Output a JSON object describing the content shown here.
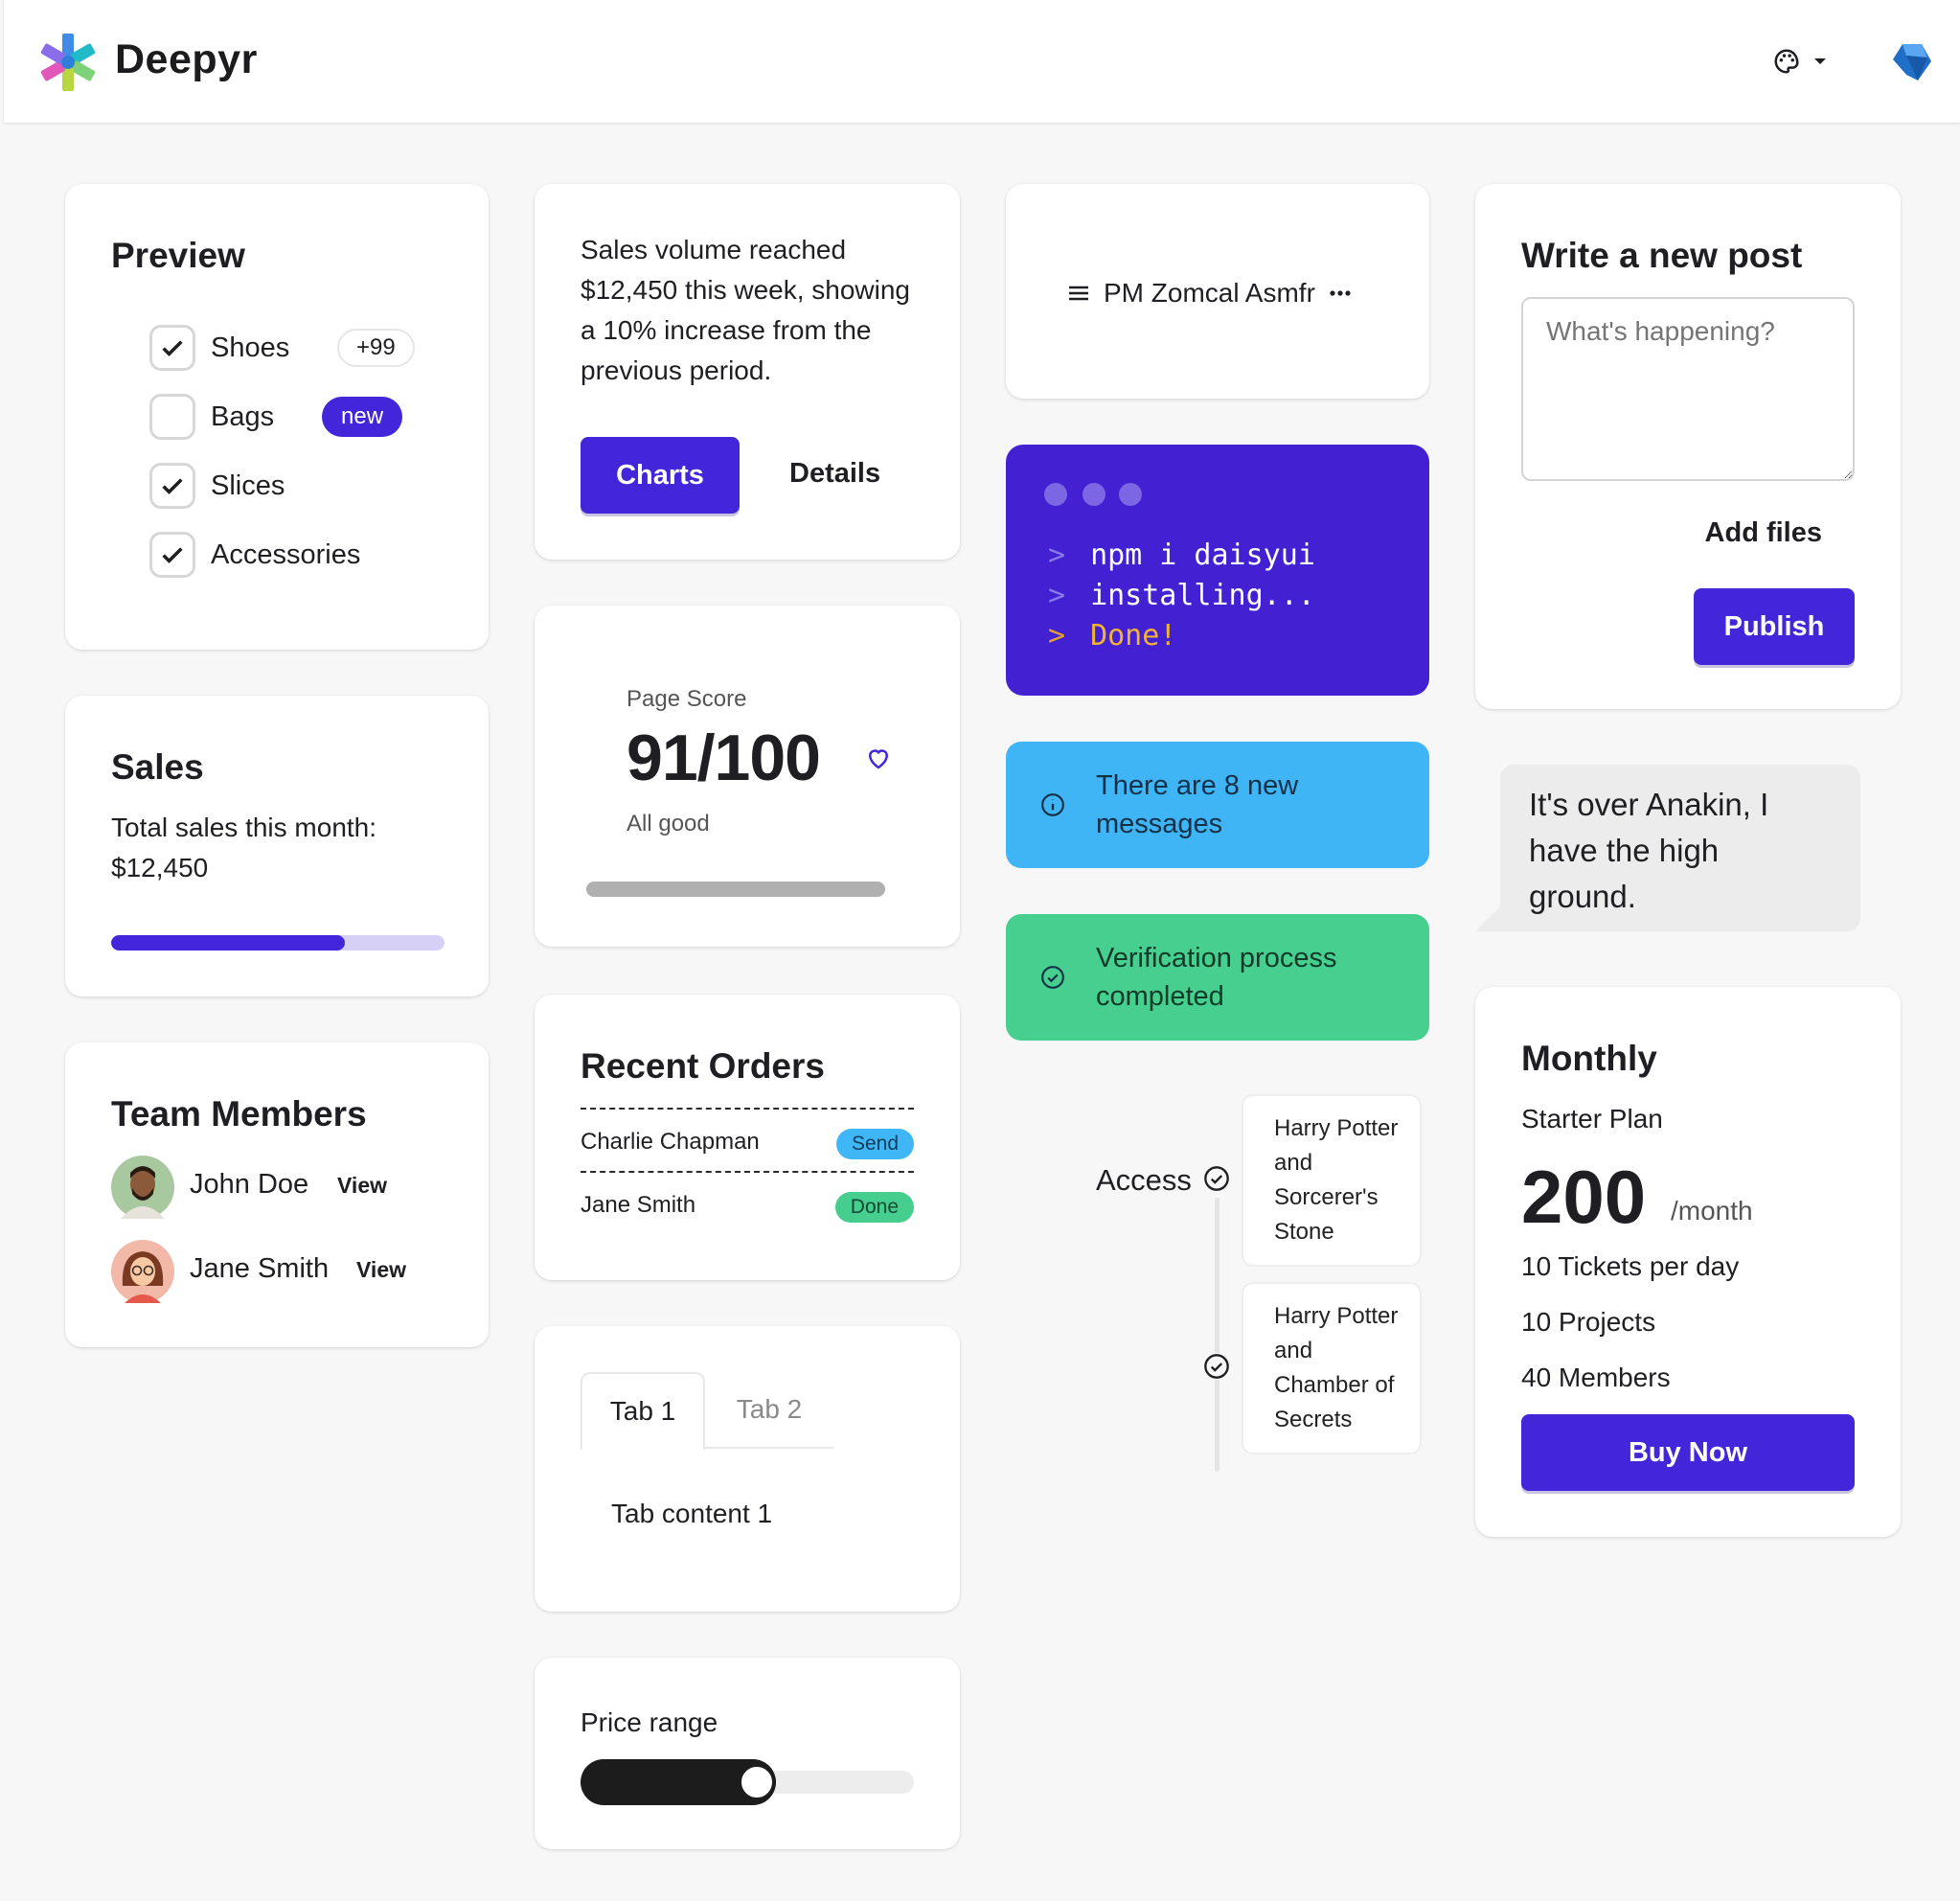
{
  "brand": {
    "name": "Deepyr"
  },
  "navbar": {
    "theme_icon": "palette-icon",
    "menu_icon": "chevron-down-icon",
    "gem_icon": "diamond-icon"
  },
  "colors": {
    "primary": "#4326d9",
    "info": "#3fb6f5",
    "success": "#46ce8f",
    "terminal": "#4321d3",
    "done": "#f2b235"
  },
  "preview": {
    "title": "Preview",
    "items": [
      {
        "label": "Shoes",
        "checked": true,
        "badge": "+99"
      },
      {
        "label": "Bags",
        "checked": false,
        "badge": "new"
      },
      {
        "label": "Slices",
        "checked": true
      },
      {
        "label": "Accessories",
        "checked": true
      }
    ]
  },
  "sales": {
    "title": "Sales",
    "text": "Total sales this month:",
    "amount": "$12,450",
    "progress_fraction": 0.7
  },
  "team": {
    "title": "Team Members",
    "members": [
      {
        "name": "John Doe",
        "action": "View"
      },
      {
        "name": "Jane Smith",
        "action": "View"
      }
    ]
  },
  "volume": {
    "text": "Sales volume reached $12,450 this week, showing a 10% increase from the previous period.",
    "primary_label": "Charts",
    "secondary_label": "Details"
  },
  "score": {
    "label": "Page Score",
    "value": "91/100",
    "status": "All good"
  },
  "orders": {
    "title": "Recent Orders",
    "rows": [
      {
        "name": "Charlie Chapman",
        "status": "Send"
      },
      {
        "name": "Jane Smith",
        "status": "Done"
      }
    ]
  },
  "tabs": {
    "items": [
      "Tab 1",
      "Tab 2"
    ],
    "active": 0,
    "content": "Tab content 1"
  },
  "price": {
    "label": "Price range",
    "value_fraction": 0.5
  },
  "menu_card": {
    "label": "PM Zomcal Asmfr"
  },
  "terminal": {
    "lines": [
      {
        "prefix": ">",
        "text": "npm i daisyui"
      },
      {
        "prefix": ">",
        "text": "installing..."
      },
      {
        "prefix": ">",
        "text": "Done!"
      }
    ]
  },
  "alerts": {
    "info": "There are 8 new messages",
    "success": "Verification process completed"
  },
  "timeline": {
    "label": "Access",
    "items": [
      "Harry Potter and Sorcerer's Stone",
      "Harry Potter and Chamber of Secrets"
    ]
  },
  "post": {
    "title": "Write a new post",
    "placeholder": "What's happening?",
    "add_files": "Add files",
    "publish": "Publish"
  },
  "chat": {
    "text": "It's over Anakin, I have the high ground."
  },
  "pricing": {
    "title": "Monthly",
    "plan": "Starter Plan",
    "price": "200",
    "period": "/month",
    "features": [
      "10 Tickets per day",
      "10 Projects",
      "40 Members"
    ],
    "cta": "Buy Now"
  }
}
